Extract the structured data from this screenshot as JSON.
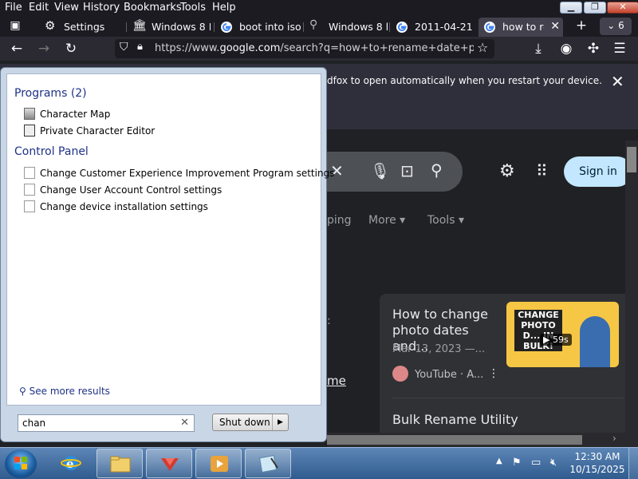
{
  "menubar": {
    "items": [
      "File",
      "Edit",
      "View",
      "History",
      "Bookmarks",
      "Tools",
      "Help"
    ]
  },
  "tabs": [
    {
      "label": "Settings",
      "icon": "gear-icon"
    },
    {
      "label": "Windows 8 B",
      "icon": "library-icon"
    },
    {
      "label": "boot into iso",
      "icon": "google-icon"
    },
    {
      "label": "Windows 8 b",
      "icon": "search-icon"
    },
    {
      "label": "2011-04-21 -",
      "icon": "google-icon"
    },
    {
      "label": "how to rer",
      "icon": "google-icon"
    }
  ],
  "tab_count": "6",
  "url": {
    "prefix": "https://www.",
    "domain": "google.com",
    "rest": "/search?q=how+to+rename+date+pc+w"
  },
  "notification": {
    "text": "dfox to open automatically when you restart your device."
  },
  "google": {
    "signin": "Sign in",
    "filters": [
      "ping",
      "More",
      "Tools"
    ],
    "card": {
      "title": "How to change photo dates and...",
      "date": "Mar 13, 2023 —...",
      "source": "YouTube · A...",
      "thumb_text": "CHANGE PHOTO D... IN BULK!",
      "duration": "59s"
    },
    "next_result": "Bulk Rename Utility",
    "link_fragment": "me"
  },
  "startmenu": {
    "programs_header": "Programs (2)",
    "programs": [
      "Character Map",
      "Private Character Editor"
    ],
    "control_header": "Control Panel",
    "control_items": [
      "Change Customer Experience Improvement Program settings",
      "Change User Account Control settings",
      "Change device installation settings"
    ],
    "see_more": "See more results",
    "search_value": "chan",
    "shutdown": "Shut down"
  },
  "clock": {
    "time": "12:30 AM",
    "date": "10/15/2025"
  },
  "colors": {
    "accent": "#1e3287",
    "signin_bg": "#c2e7ff",
    "page_bg": "#202124"
  }
}
